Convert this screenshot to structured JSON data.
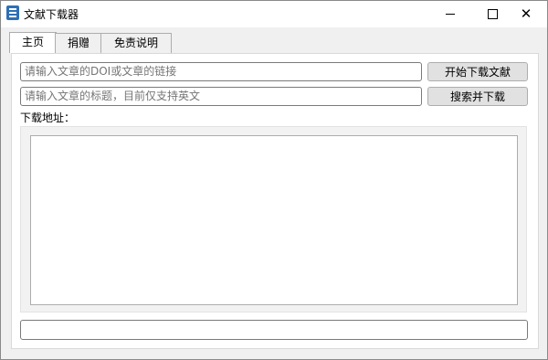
{
  "window": {
    "title": "文献下载器",
    "icon": "book-icon",
    "controls": {
      "minimize": "minimize-icon",
      "maximize": "maximize-icon",
      "close": "close-icon"
    }
  },
  "tabs": [
    {
      "label": "主页",
      "active": true
    },
    {
      "label": "捐赠",
      "active": false
    },
    {
      "label": "免责说明",
      "active": false
    }
  ],
  "main": {
    "doi_input": {
      "placeholder": "请输入文章的DOI或文章的链接",
      "value": ""
    },
    "download_button": "开始下载文献",
    "title_input": {
      "placeholder": "请输入文章的标题，目前仅支持英文",
      "value": ""
    },
    "search_button": "搜索并下载",
    "address_label": "下载地址：",
    "address_value": "",
    "status_value": ""
  }
}
